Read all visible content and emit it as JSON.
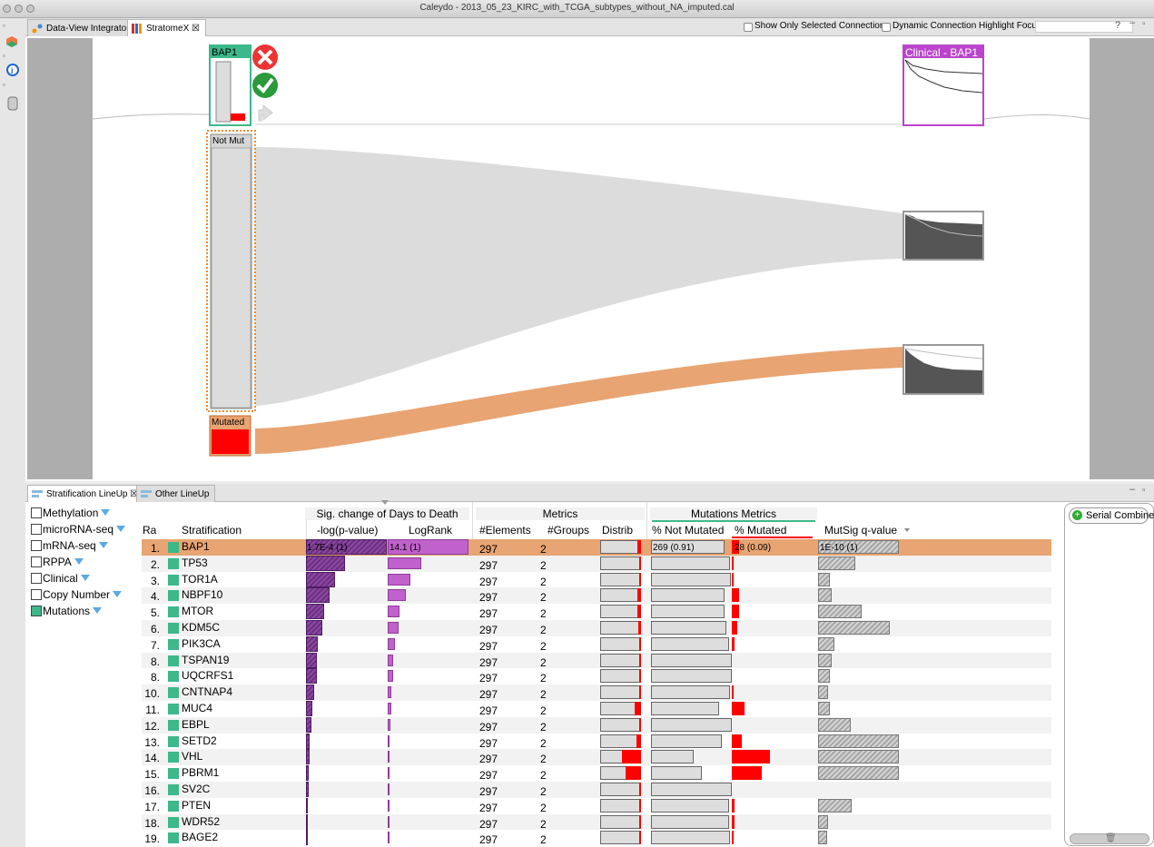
{
  "window": {
    "title": "Caleydo - 2013_05_23_KIRC_with_TCGA_subtypes_without_NA_imputed.cal"
  },
  "tabs": [
    {
      "label": "Data-View Integrator"
    },
    {
      "label": "StratomeX ☒"
    }
  ],
  "toolbar": {
    "show_selected": "Show Only Selected Connections",
    "dynamic_highlight": "Dynamic Connection Highlight Focus"
  },
  "stratomex": {
    "col_title": "BAP1",
    "group_not_mut": "Not Mut",
    "group_mutated": "Mutated",
    "clinical_title": "Clinical - BAP1"
  },
  "lower_tabs": [
    {
      "label": "Stratification LineUp ☒"
    },
    {
      "label": "Other LineUp"
    }
  ],
  "datasets": [
    {
      "label": "Methylation",
      "checked": false
    },
    {
      "label": "microRNA-seq",
      "checked": false
    },
    {
      "label": "mRNA-seq",
      "checked": false
    },
    {
      "label": "RPPA",
      "checked": false
    },
    {
      "label": "Clinical",
      "checked": false
    },
    {
      "label": "Copy Number",
      "checked": false
    },
    {
      "label": "Mutations",
      "checked": true
    }
  ],
  "lineup": {
    "group_sig": "Sig. change of Days to Death",
    "group_metrics": "Metrics",
    "group_mut": "Mutations Metrics",
    "h_rank": "Ra",
    "h_strat": "Stratification",
    "h_pval": "-log(p-value)",
    "h_logrank": "LogRank",
    "h_elements": "#Elements",
    "h_groups": "#Groups",
    "h_distrib": "Distrib",
    "h_notmut": "% Not Mutated",
    "h_mutated": "% Mutated",
    "h_mutsig": "MutSig q-value",
    "serial_combiner": "Serial Combiner",
    "rows": [
      {
        "rank": "1.",
        "name": "BAP1",
        "pval": 1.0,
        "logrank": 1.0,
        "pval_text": "1.7E-4 (1)",
        "logrank_text": "14.1 (1)",
        "elements": "297",
        "groups": "2",
        "mut": 0.09,
        "notmut_text": "269 (0.91)",
        "mut_text": "28 (0.09)",
        "mutsig": 1.0,
        "mutsig_text": "1E-10 (1)"
      },
      {
        "rank": "2.",
        "name": "TP53",
        "pval": 0.48,
        "logrank": 0.42,
        "elements": "297",
        "groups": "2",
        "mut": 0.02,
        "mutsig": 0.46
      },
      {
        "rank": "3.",
        "name": "TOR1A",
        "pval": 0.36,
        "logrank": 0.28,
        "elements": "297",
        "groups": "2",
        "mut": 0.01,
        "mutsig": 0.15
      },
      {
        "rank": "4.",
        "name": "NBPF10",
        "pval": 0.29,
        "logrank": 0.22,
        "elements": "297",
        "groups": "2",
        "mut": 0.09,
        "mutsig": 0.17
      },
      {
        "rank": "5.",
        "name": "MTOR",
        "pval": 0.22,
        "logrank": 0.15,
        "elements": "297",
        "groups": "2",
        "mut": 0.09,
        "mutsig": 0.54
      },
      {
        "rank": "6.",
        "name": "KDM5C",
        "pval": 0.2,
        "logrank": 0.13,
        "elements": "297",
        "groups": "2",
        "mut": 0.07,
        "mutsig": 0.89
      },
      {
        "rank": "7.",
        "name": "PIK3CA",
        "pval": 0.15,
        "logrank": 0.09,
        "elements": "297",
        "groups": "2",
        "mut": 0.03,
        "mutsig": 0.2
      },
      {
        "rank": "8.",
        "name": "TSPAN19",
        "pval": 0.13,
        "logrank": 0.07,
        "elements": "297",
        "groups": "2",
        "mut": 0.0,
        "mutsig": 0.17
      },
      {
        "rank": "8.",
        "name": "UQCRFS1",
        "pval": 0.13,
        "logrank": 0.07,
        "elements": "297",
        "groups": "2",
        "mut": 0.0,
        "mutsig": 0.15
      },
      {
        "rank": "10.",
        "name": "CNTNAP4",
        "pval": 0.1,
        "logrank": 0.05,
        "elements": "297",
        "groups": "2",
        "mut": 0.02,
        "mutsig": 0.12
      },
      {
        "rank": "11.",
        "name": "MUC4",
        "pval": 0.08,
        "logrank": 0.04,
        "elements": "297",
        "groups": "2",
        "mut": 0.16,
        "mutsig": 0.15
      },
      {
        "rank": "12.",
        "name": "EBPL",
        "pval": 0.07,
        "logrank": 0.03,
        "elements": "297",
        "groups": "2",
        "mut": 0.0,
        "mutsig": 0.4
      },
      {
        "rank": "13.",
        "name": "SETD2",
        "pval": 0.05,
        "logrank": 0.02,
        "elements": "297",
        "groups": "2",
        "mut": 0.12,
        "mutsig": 1.0
      },
      {
        "rank": "14.",
        "name": "VHL",
        "pval": 0.04,
        "logrank": 0.02,
        "elements": "297",
        "groups": "2",
        "mut": 0.47,
        "mutsig": 1.0
      },
      {
        "rank": "15.",
        "name": "PBRM1",
        "pval": 0.03,
        "logrank": 0.01,
        "elements": "297",
        "groups": "2",
        "mut": 0.37,
        "mutsig": 1.0
      },
      {
        "rank": "16.",
        "name": "SV2C",
        "pval": 0.03,
        "logrank": 0.01,
        "elements": "297",
        "groups": "2",
        "mut": 0.0,
        "mutsig": 0.0
      },
      {
        "rank": "17.",
        "name": "PTEN",
        "pval": 0.02,
        "logrank": 0.01,
        "elements": "297",
        "groups": "2",
        "mut": 0.03,
        "mutsig": 0.42
      },
      {
        "rank": "18.",
        "name": "WDR52",
        "pval": 0.02,
        "logrank": 0.01,
        "elements": "297",
        "groups": "2",
        "mut": 0.03,
        "mutsig": 0.12
      },
      {
        "rank": "19.",
        "name": "BAGE2",
        "pval": 0.01,
        "logrank": 0.0,
        "elements": "297",
        "groups": "2",
        "mut": 0.02,
        "mutsig": 0.11
      }
    ]
  },
  "colors": {
    "accent_selected": "#e8a472",
    "group_green": "#3cb88a",
    "clinical_border": "#bb44cc",
    "mutated_red": "#ff0000",
    "ribbon_gray": "#dcdcdc",
    "ribbon_orange": "#e8a472"
  }
}
